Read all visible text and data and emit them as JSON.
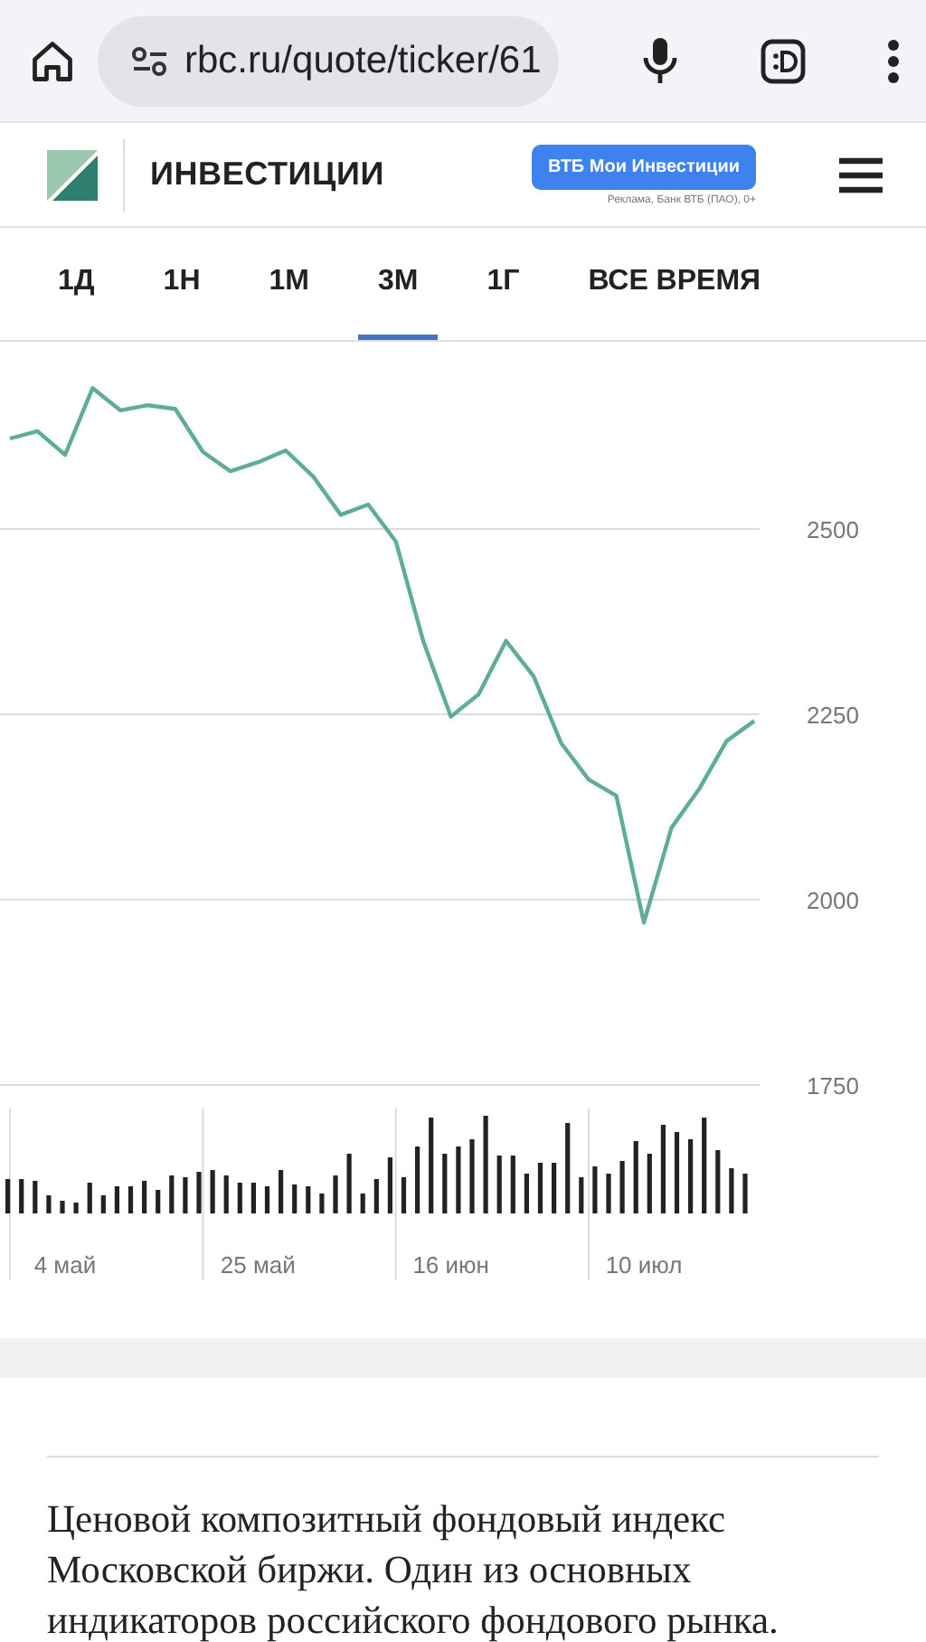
{
  "browser": {
    "url": "rbc.ru/quote/ticker/61"
  },
  "header": {
    "title": "ИНВЕСТИЦИИ",
    "ad_button": "ВТБ Мои Инвестиции",
    "ad_note": "Реклама, Банк ВТБ (ПАО), 0+"
  },
  "tabs": [
    {
      "label": "1Д",
      "selected": false
    },
    {
      "label": "1Н",
      "selected": false
    },
    {
      "label": "1М",
      "selected": false
    },
    {
      "label": "3М",
      "selected": true
    },
    {
      "label": "1Г",
      "selected": false
    },
    {
      "label": "ВСЕ ВРЕМЯ",
      "selected": false
    }
  ],
  "chart": {
    "chart_data": {
      "type": "line",
      "grid": true,
      "ylim": [
        1750,
        2755
      ],
      "yticks": [
        1750,
        2000,
        2250,
        2500
      ],
      "categories": [
        null,
        null,
        "4 май",
        null,
        null,
        null,
        null,
        null,
        null,
        "25 май",
        null,
        null,
        null,
        null,
        null,
        null,
        "16 июн",
        null,
        null,
        null,
        null,
        null,
        null,
        "10 июл",
        null,
        null,
        null,
        null
      ],
      "series": [
        {
          "color": "#5fae8e",
          "values": [
            2622,
            2632,
            2600,
            2690,
            2660,
            2667,
            2662,
            2604,
            2578,
            2590,
            2606,
            2571,
            2519,
            2533,
            2483,
            2348,
            2247,
            2277,
            2349,
            2301,
            2211,
            2162,
            2140,
            1969,
            2097,
            2149,
            2214,
            2241
          ]
        }
      ]
    }
  },
  "description": "Ценовой композитный фондовый индекс Московской биржи. Один из основных индикаторов российского фондового рынка."
}
